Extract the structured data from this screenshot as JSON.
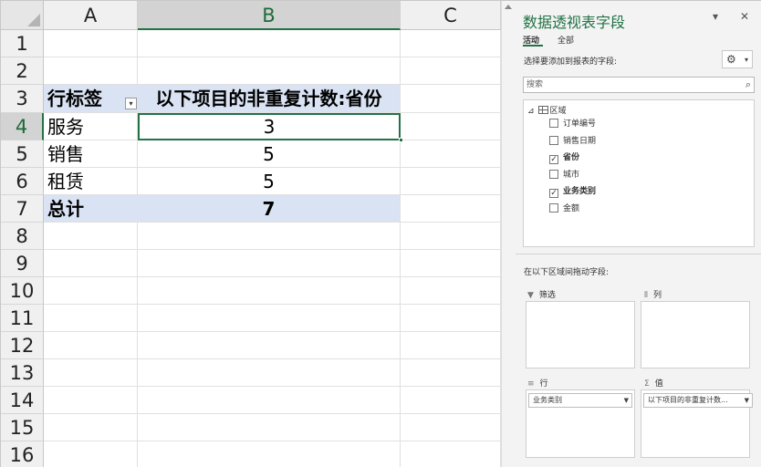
{
  "sheet": {
    "columns": [
      "A",
      "B",
      "C"
    ],
    "rows": [
      "1",
      "2",
      "3",
      "4",
      "5",
      "6",
      "7",
      "8",
      "9",
      "10",
      "11",
      "12",
      "13",
      "14",
      "15",
      "16"
    ],
    "pivot": {
      "header_row_label": "行标签",
      "header_value_label": "以下项目的非重复计数:省份",
      "items": [
        {
          "label": "服务",
          "value": "3"
        },
        {
          "label": "销售",
          "value": "5"
        },
        {
          "label": "租赁",
          "value": "5"
        }
      ],
      "total": {
        "label": "总计",
        "value": "7"
      }
    },
    "filter_glyph": "▾"
  },
  "pane": {
    "title": "数据透视表字段",
    "pin_glyph": "▾",
    "close_glyph": "✕",
    "tabs": [
      "活动",
      "全部"
    ],
    "choose_hint": "选择要添加到报表的字段:",
    "gear_glyph": "⚙",
    "search_placeholder": "搜索",
    "search_glyph": "⌕",
    "tree_toggle": "⊿",
    "region": "区域",
    "fields": [
      {
        "name": "订单编号",
        "checked": false
      },
      {
        "name": "销售日期",
        "checked": false
      },
      {
        "name": "省份",
        "checked": true
      },
      {
        "name": "城市",
        "checked": false
      },
      {
        "name": "业务类别",
        "checked": true
      },
      {
        "name": "金额",
        "checked": false
      }
    ],
    "drag_hint": "在以下区域间拖动字段:",
    "areas": {
      "filter": {
        "label": "筛选",
        "icon": "▼"
      },
      "columns": {
        "label": "列",
        "icon": "⦀"
      },
      "rows": {
        "label": "行",
        "icon": "≡",
        "chip": "业务类别"
      },
      "values": {
        "label": "值",
        "icon": "Σ",
        "chip": "以下项目的非重复计数..."
      }
    }
  }
}
